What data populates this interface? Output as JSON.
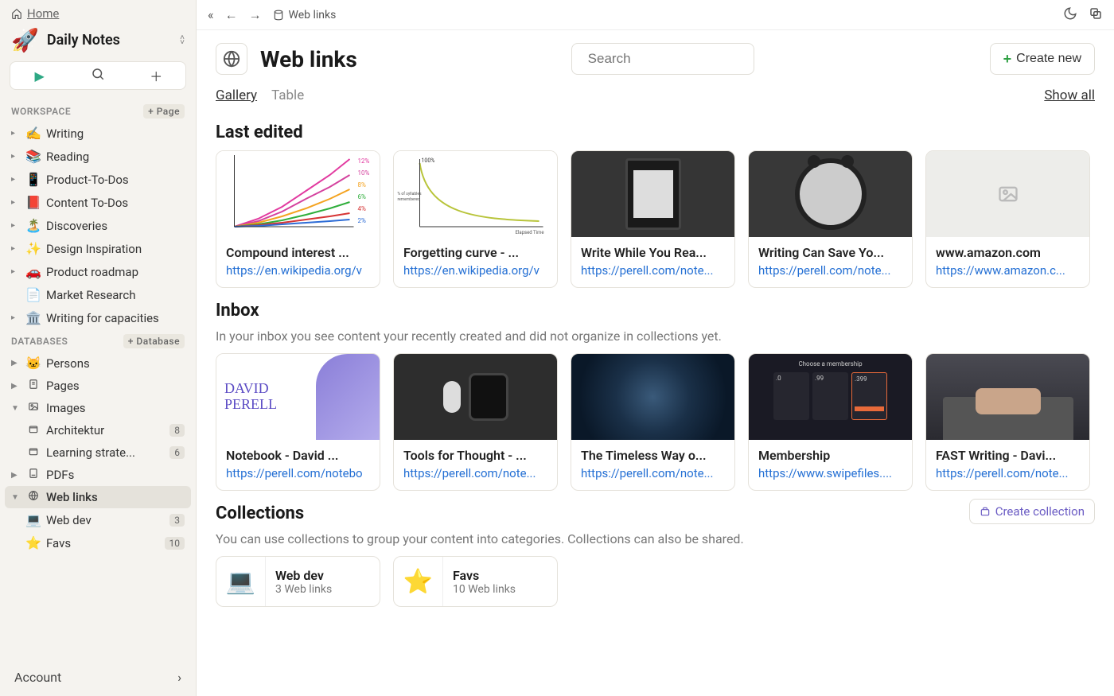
{
  "home": {
    "label": "Home"
  },
  "daily": {
    "title": "Daily Notes"
  },
  "workspace": {
    "header": "WORKSPACE",
    "add_label": "+ Page",
    "items": [
      {
        "emoji": "✍️",
        "label": "Writing"
      },
      {
        "emoji": "📚",
        "label": "Reading"
      },
      {
        "emoji": "📱",
        "label": "Product-To-Dos"
      },
      {
        "emoji": "📕",
        "label": "Content To-Dos"
      },
      {
        "emoji": "🏝️",
        "label": "Discoveries"
      },
      {
        "emoji": "✨",
        "label": "Design Inspiration"
      },
      {
        "emoji": "🚗",
        "label": "Product roadmap"
      },
      {
        "emoji": "📄",
        "label": "Market Research",
        "doc": true
      },
      {
        "emoji": "🏛️",
        "label": "Writing for capacities"
      }
    ]
  },
  "databases": {
    "header": "DATABASES",
    "add_label": "+ Database",
    "items": [
      {
        "emoji": "🐱",
        "label": "Persons",
        "caret": "▶"
      },
      {
        "icon": "page",
        "label": "Pages",
        "caret": "▶"
      },
      {
        "icon": "image",
        "label": "Images",
        "caret": "▼",
        "expanded": true,
        "children": [
          {
            "icon": "box",
            "label": "Architektur",
            "badge": "8"
          },
          {
            "icon": "box",
            "label": "Learning strate...",
            "badge": "6"
          }
        ]
      },
      {
        "icon": "pdf",
        "label": "PDFs",
        "caret": "▶"
      },
      {
        "icon": "globe",
        "label": "Web links",
        "caret": "▼",
        "active": true,
        "children": [
          {
            "emoji": "💻",
            "label": "Web dev",
            "badge": "3"
          },
          {
            "emoji": "⭐",
            "label": "Favs",
            "badge": "10"
          }
        ]
      }
    ]
  },
  "account": {
    "label": "Account"
  },
  "breadcrumb": {
    "label": "Web links"
  },
  "page": {
    "title": "Web links",
    "search_placeholder": "Search",
    "create_label": "Create new"
  },
  "view_tabs": {
    "gallery": "Gallery",
    "table": "Table",
    "show_all": "Show all"
  },
  "last_edited": {
    "title": "Last edited",
    "cards": [
      {
        "title": "Compound interest ...",
        "url": "https://en.wikipedia.org/v",
        "thumb": "chart1"
      },
      {
        "title": "Forgetting curve - ...",
        "url": "https://en.wikipedia.org/v",
        "thumb": "chart2"
      },
      {
        "title": "Write While You Rea...",
        "url": "https://perell.com/note...",
        "thumb": "dark"
      },
      {
        "title": "Writing Can Save Yo...",
        "url": "https://perell.com/note...",
        "thumb": "dark2"
      },
      {
        "title": "www.amazon.com",
        "url": "https://www.amazon.c...",
        "thumb": "placeholder"
      }
    ]
  },
  "inbox": {
    "title": "Inbox",
    "desc": "In your inbox you see content your recently created and did not organize in collections yet.",
    "cards": [
      {
        "title": "Notebook - David ...",
        "url": "https://perell.com/notebo",
        "thumb": "perell"
      },
      {
        "title": "Tools for Thought - ...",
        "url": "https://perell.com/note...",
        "thumb": "dark3"
      },
      {
        "title": "The Timeless Way o...",
        "url": "https://perell.com/note...",
        "thumb": "pattern"
      },
      {
        "title": "Membership",
        "url": "https://www.swipefiles....",
        "thumb": "membership"
      },
      {
        "title": "FAST Writing - Davi...",
        "url": "https://perell.com/note...",
        "thumb": "typing"
      }
    ]
  },
  "collections": {
    "title": "Collections",
    "create_label": "Create collection",
    "desc": "You can use collections to group your content into categories. Collections can also be shared.",
    "items": [
      {
        "emoji": "💻",
        "title": "Web dev",
        "sub": "3 Web links"
      },
      {
        "emoji": "⭐",
        "title": "Favs",
        "sub": "10 Web links"
      }
    ]
  }
}
